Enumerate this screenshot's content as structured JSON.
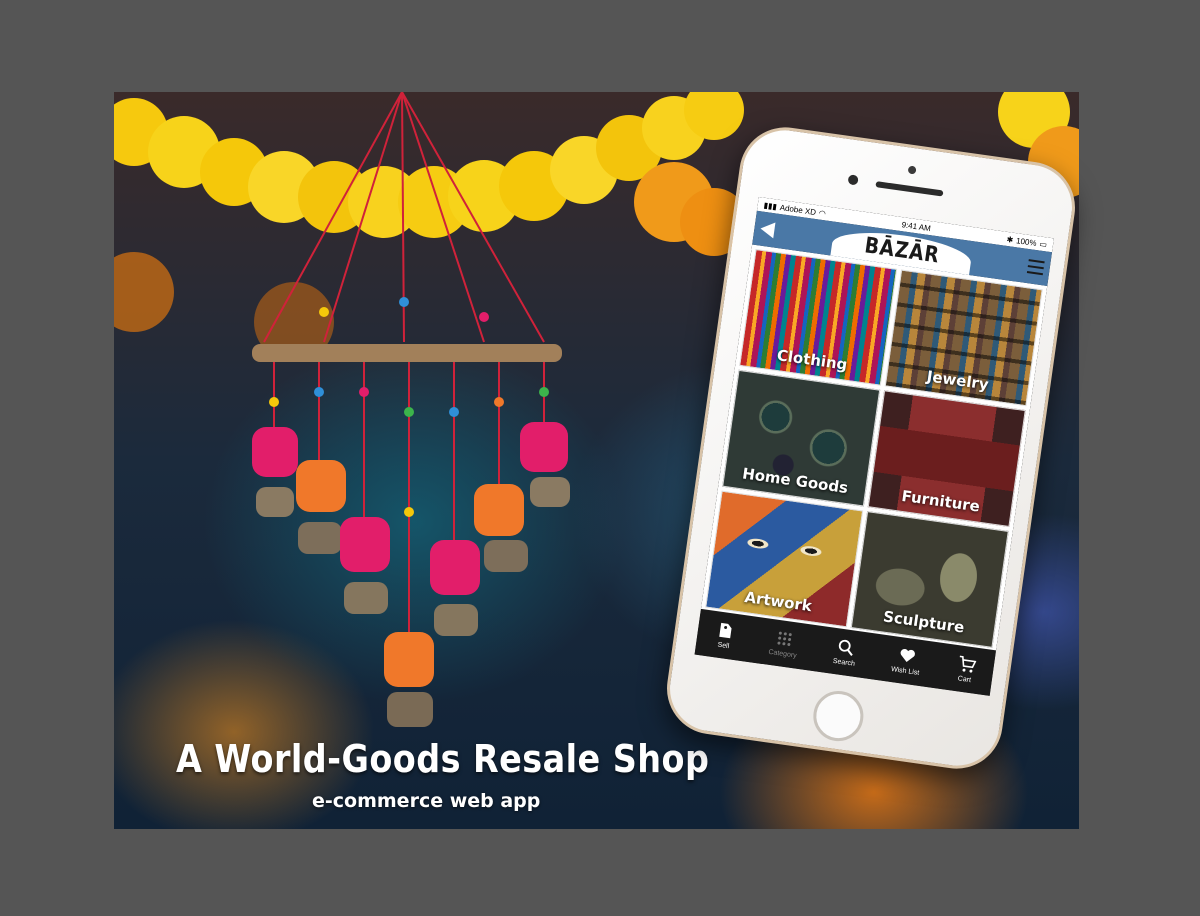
{
  "poster": {
    "title": "A World-Goods  Resale Shop",
    "subtitle": "e-commerce web app"
  },
  "phone": {
    "status": {
      "carrier": "Adobe XD",
      "time": "9:41 AM",
      "battery": "100%"
    },
    "app": {
      "logo": "BĀZĀR"
    },
    "categories": [
      {
        "label": "Clothing"
      },
      {
        "label": "Jewelry"
      },
      {
        "label": "Home Goods"
      },
      {
        "label": "Furniture"
      },
      {
        "label": "Artwork"
      },
      {
        "label": "Sculpture"
      }
    ],
    "tabs": [
      {
        "label": "Sell",
        "icon": "tag-icon"
      },
      {
        "label": "Category",
        "icon": "grid-icon"
      },
      {
        "label": "Search",
        "icon": "search-icon"
      },
      {
        "label": "Wish List",
        "icon": "heart-icon"
      },
      {
        "label": "Cart",
        "icon": "cart-icon"
      }
    ]
  },
  "colors": {
    "appbar": "#4a78a6",
    "tabbar": "#1a1a1a",
    "background": "#555555"
  }
}
